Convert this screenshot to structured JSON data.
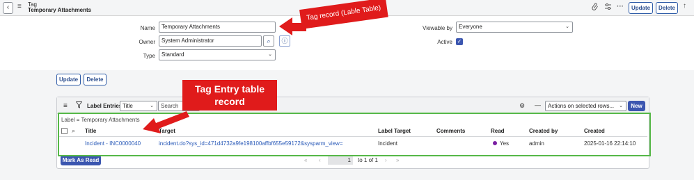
{
  "header": {
    "title_line1": "Tag",
    "title_line2": "Temporary Attachments",
    "update_label": "Update",
    "delete_label": "Delete"
  },
  "form": {
    "name_label": "Name",
    "name_value": "Temporary Attachments",
    "owner_label": "Owner",
    "owner_value": "System Administrator",
    "type_label": "Type",
    "type_value": "Standard",
    "viewable_label": "Viewable by",
    "viewable_value": "Everyone",
    "active_label": "Active"
  },
  "actions": {
    "update_label": "Update",
    "delete_label": "Delete"
  },
  "related_list": {
    "title": "Label Entries",
    "search_field": "Title",
    "search_placeholder": "Search",
    "actions_select": "Actions on selected rows...",
    "new_label": "New",
    "breadcrumb": "Label = Temporary Attachments",
    "columns": [
      "Title",
      "Target",
      "Label Target",
      "Comments",
      "Read",
      "Created by",
      "Created"
    ],
    "row": {
      "title": "Incident - INC0000040",
      "target": "incident.do?sys_id=471d4732a9fe198100affbf655e59172&sysparm_view=",
      "label_target": "Incident",
      "comments": "",
      "read": "Yes",
      "created_by": "admin",
      "created": "2025-01-16 22:14:10"
    },
    "mark_as_read_label": "Mark As Read",
    "pagination": {
      "current": "1",
      "range_text": "to 1 of 1"
    }
  },
  "annotations": {
    "tag_record": "Tag record (Lable Table)",
    "tag_entry_line1": "Tag Entry table",
    "tag_entry_line2": "record"
  },
  "colors": {
    "accent": "#3b56b0",
    "callout": "#e01b1b",
    "highlight_box": "#56b848",
    "link": "#2a5ab8",
    "read_dot": "#7a1fa2"
  }
}
